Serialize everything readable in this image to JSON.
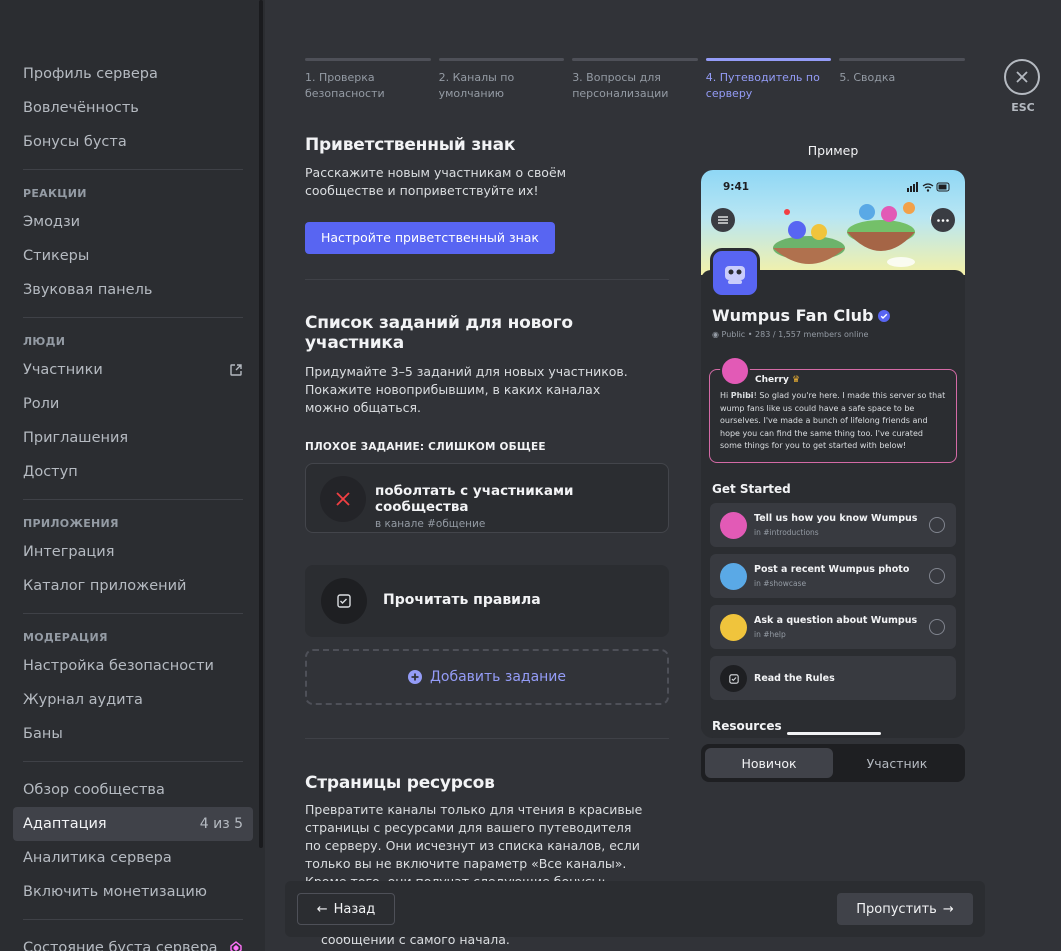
{
  "sidebar": {
    "group1": [
      {
        "label": "Профиль сервера"
      },
      {
        "label": "Вовлечённость"
      },
      {
        "label": "Бонусы буста"
      }
    ],
    "reactions_header": "РЕАКЦИИ",
    "reactions": [
      {
        "label": "Эмодзи"
      },
      {
        "label": "Стикеры"
      },
      {
        "label": "Звуковая панель"
      }
    ],
    "people_header": "ЛЮДИ",
    "people": [
      {
        "label": "Участники"
      },
      {
        "label": "Роли"
      },
      {
        "label": "Приглашения"
      },
      {
        "label": "Доступ"
      }
    ],
    "apps_header": "ПРИЛОЖЕНИЯ",
    "apps": [
      {
        "label": "Интеграция"
      },
      {
        "label": "Каталог приложений"
      }
    ],
    "moderation_header": "МОДЕРАЦИЯ",
    "moderation": [
      {
        "label": "Настройка безопасности"
      },
      {
        "label": "Журнал аудита"
      },
      {
        "label": "Баны"
      }
    ],
    "community": [
      {
        "label": "Обзор сообщества"
      },
      {
        "label": "Адаптация",
        "extra": "4 из 5"
      },
      {
        "label": "Аналитика сервера"
      },
      {
        "label": "Включить монетизацию"
      }
    ],
    "boost_status": "Состояние буста сервера"
  },
  "steps": [
    {
      "label": "1. Проверка безопасности"
    },
    {
      "label": "2. Каналы по умолчанию"
    },
    {
      "label": "3. Вопросы для персонализации"
    },
    {
      "label": "4. Путеводитель по серверу"
    },
    {
      "label": "5. Сводка"
    }
  ],
  "esc_label": "ESC",
  "welcome_sign": {
    "title": "Приветственный знак",
    "description": "Расскажите новым участникам о своём сообществе и поприветствуйте их!",
    "button": "Настройте приветственный знак"
  },
  "tasks_section": {
    "title": "Список заданий для нового участника",
    "description": "Придумайте 3–5 заданий для новых участников. Покажите новоприбывшим, в каких каналах можно общаться.",
    "bad_label": "ПЛОХОЕ ЗАДАНИЕ: СЛИШКОМ ОБЩЕЕ",
    "bad_task_title": "поболтать с участниками сообщества",
    "bad_task_sub": "в канале #общение",
    "good_task_title": "Прочитать правила",
    "add_task": "Добавить задание"
  },
  "resources_section": {
    "title": "Страницы ресурсов",
    "description": "Превратите каналы только для чтения в красивые страницы с ресурсами для вашего путеводителя по серверу. Они исчезнут из списка каналов, если только вы не включите параметр «Все каналы». Кроме того, они получат следующие бонусы:",
    "trailing": "сообщении с самого начала."
  },
  "preview": {
    "label": "Пример",
    "time": "9:41",
    "server_name": "Wumpus Fan Club",
    "meta_public": "Public",
    "meta_members": "283 / 1,557 members online",
    "welcome_author": "Cherry",
    "welcome_text_pre": "Hi ",
    "welcome_text_name": "Phibi",
    "welcome_text_post": "! So glad you're here. I made this server so that wump fans like us could have a safe space to be ourselves. I've made a bunch of lifelong friends and hope you can find the same thing too. I've curated some things for you to get started with below!",
    "get_started": "Get Started",
    "tasks": [
      {
        "title": "Tell us how you know Wumpus",
        "channel": "in #introductions",
        "color": "#e25ab6"
      },
      {
        "title": "Post a recent Wumpus photo",
        "channel": "in #showcase",
        "color": "#5aa9e6"
      },
      {
        "title": "Ask a question about Wumpus",
        "channel": "in #help",
        "color": "#f0c43c"
      },
      {
        "title": "Read the Rules",
        "channel": ""
      }
    ],
    "resources": "Resources"
  },
  "toggle": {
    "newbie": "Новичок",
    "member": "Участник"
  },
  "footer": {
    "back": "Назад",
    "skip": "Пропустить"
  },
  "colors": {
    "accent": "#5865f2",
    "accent_light": "#949cf7",
    "danger": "#f23f43",
    "boost": "#ff73fa"
  }
}
